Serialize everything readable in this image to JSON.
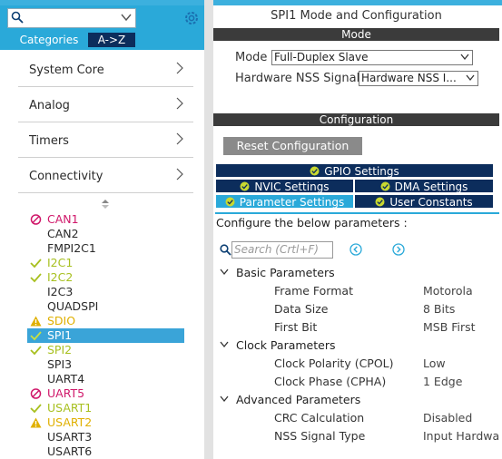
{
  "left": {
    "search_placeholder": "",
    "tabs": {
      "categories": "Categories",
      "az": "A->Z"
    },
    "categories": [
      {
        "label": "System Core"
      },
      {
        "label": "Analog"
      },
      {
        "label": "Timers"
      },
      {
        "label": "Connectivity"
      }
    ],
    "peripherals": [
      {
        "label": "CAN1",
        "status": "disabled"
      },
      {
        "label": "CAN2",
        "status": "none"
      },
      {
        "label": "FMPI2C1",
        "status": "none"
      },
      {
        "label": "I2C1",
        "status": "ok"
      },
      {
        "label": "I2C2",
        "status": "ok"
      },
      {
        "label": "I2C3",
        "status": "none"
      },
      {
        "label": "QUADSPI",
        "status": "none"
      },
      {
        "label": "SDIO",
        "status": "warning"
      },
      {
        "label": "SPI1",
        "status": "selected"
      },
      {
        "label": "SPI2",
        "status": "ok"
      },
      {
        "label": "SPI3",
        "status": "none"
      },
      {
        "label": "UART4",
        "status": "none"
      },
      {
        "label": "UART5",
        "status": "disabled"
      },
      {
        "label": "USART1",
        "status": "ok"
      },
      {
        "label": "USART2",
        "status": "warning"
      },
      {
        "label": "USART3",
        "status": "none"
      },
      {
        "label": "USART6",
        "status": "none"
      }
    ],
    "colors": {
      "ok": "#a8c020",
      "warning": "#e0b000",
      "disabled": "#d0186a",
      "selected_bg": "#3aa4d8"
    }
  },
  "right": {
    "title": "SPI1 Mode and Configuration",
    "mode_header": "Mode",
    "mode_label": "Mode",
    "mode_value": "Full-Duplex Slave",
    "nss_label": "Hardware NSS Signal",
    "nss_value": "Hardware NSS I...",
    "config_header": "Configuration",
    "reset_button": "Reset Configuration",
    "tabs": {
      "gpio": "GPIO Settings",
      "nvic": "NVIC Settings",
      "dma": "DMA Settings",
      "parameter": "Parameter Settings",
      "user_constants": "User Constants"
    },
    "configure_text": "Configure the below parameters :",
    "search_placeholder": "Search (Crtl+F)",
    "groups": [
      {
        "name": "Basic Parameters",
        "params": [
          {
            "name": "Frame Format",
            "value": "Motorola"
          },
          {
            "name": "Data Size",
            "value": "8 Bits"
          },
          {
            "name": "First Bit",
            "value": "MSB First"
          }
        ]
      },
      {
        "name": "Clock Parameters",
        "params": [
          {
            "name": "Clock Polarity (CPOL)",
            "value": "Low"
          },
          {
            "name": "Clock Phase (CPHA)",
            "value": "1 Edge"
          }
        ]
      },
      {
        "name": "Advanced Parameters",
        "params": [
          {
            "name": "CRC Calculation",
            "value": "Disabled"
          },
          {
            "name": "NSS Signal Type",
            "value": "Input Hardwa"
          }
        ]
      }
    ]
  }
}
